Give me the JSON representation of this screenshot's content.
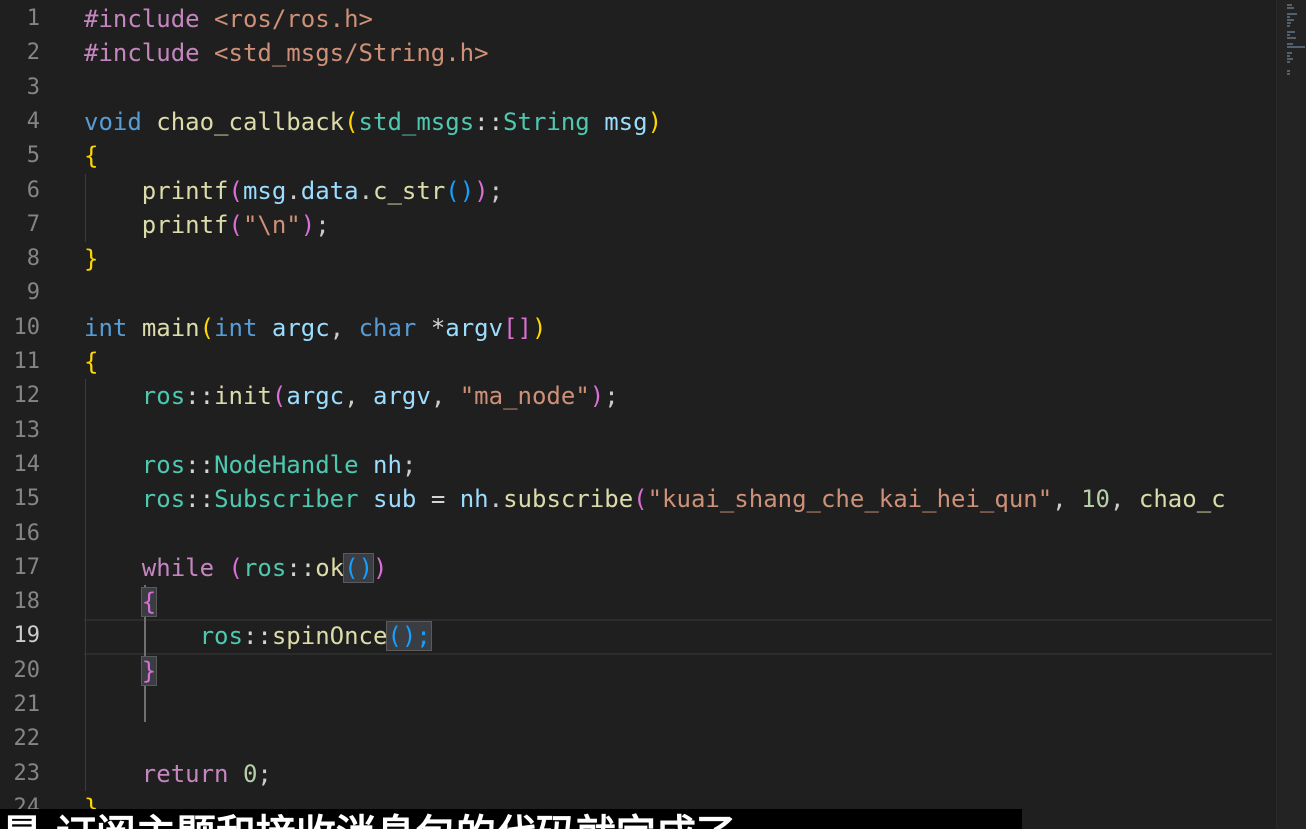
{
  "editor": {
    "active_line": 19,
    "lines": [
      [
        {
          "t": "#include",
          "c": "kw-inc"
        },
        {
          "t": " <ros/ros.h>",
          "c": "inc"
        }
      ],
      [
        {
          "t": "#include",
          "c": "kw-inc"
        },
        {
          "t": " <std_msgs/String.h>",
          "c": "inc"
        }
      ],
      [],
      [
        {
          "t": "void",
          "c": "ty"
        },
        {
          "t": " ",
          "c": "pn"
        },
        {
          "t": "chao_callback",
          "c": "fn"
        },
        {
          "t": "(",
          "c": "p1"
        },
        {
          "t": "std_msgs",
          "c": "ns"
        },
        {
          "t": "::",
          "c": "op"
        },
        {
          "t": "String",
          "c": "ns"
        },
        {
          "t": " ",
          "c": "pn"
        },
        {
          "t": "msg",
          "c": "var"
        },
        {
          "t": ")",
          "c": "p1"
        }
      ],
      [
        {
          "t": "{",
          "c": "p1"
        }
      ],
      [
        {
          "t": "    ",
          "c": "pn"
        },
        {
          "t": "printf",
          "c": "fn"
        },
        {
          "t": "(",
          "c": "p2"
        },
        {
          "t": "msg",
          "c": "var"
        },
        {
          "t": ".",
          "c": "pn"
        },
        {
          "t": "data",
          "c": "var"
        },
        {
          "t": ".",
          "c": "pn"
        },
        {
          "t": "c_str",
          "c": "fn"
        },
        {
          "t": "()",
          "c": "p3"
        },
        {
          "t": ")",
          "c": "p2"
        },
        {
          "t": ";",
          "c": "pn"
        }
      ],
      [
        {
          "t": "    ",
          "c": "pn"
        },
        {
          "t": "printf",
          "c": "fn"
        },
        {
          "t": "(",
          "c": "p2"
        },
        {
          "t": "\"\\n\"",
          "c": "str"
        },
        {
          "t": ")",
          "c": "p2"
        },
        {
          "t": ";",
          "c": "pn"
        }
      ],
      [
        {
          "t": "}",
          "c": "p1"
        }
      ],
      [],
      [
        {
          "t": "int",
          "c": "ty"
        },
        {
          "t": " ",
          "c": "pn"
        },
        {
          "t": "main",
          "c": "fn"
        },
        {
          "t": "(",
          "c": "p1"
        },
        {
          "t": "int",
          "c": "ty"
        },
        {
          "t": " ",
          "c": "pn"
        },
        {
          "t": "argc",
          "c": "var"
        },
        {
          "t": ", ",
          "c": "pn"
        },
        {
          "t": "char",
          "c": "ty"
        },
        {
          "t": " ",
          "c": "pn"
        },
        {
          "t": "*",
          "c": "op"
        },
        {
          "t": "argv",
          "c": "var"
        },
        {
          "t": "[]",
          "c": "p2"
        },
        {
          "t": ")",
          "c": "p1"
        }
      ],
      [
        {
          "t": "{",
          "c": "p1"
        }
      ],
      [
        {
          "t": "    ",
          "c": "pn"
        },
        {
          "t": "ros",
          "c": "ns"
        },
        {
          "t": "::",
          "c": "op"
        },
        {
          "t": "init",
          "c": "fn"
        },
        {
          "t": "(",
          "c": "p2"
        },
        {
          "t": "argc",
          "c": "var"
        },
        {
          "t": ", ",
          "c": "pn"
        },
        {
          "t": "argv",
          "c": "var"
        },
        {
          "t": ", ",
          "c": "pn"
        },
        {
          "t": "\"ma_node\"",
          "c": "str"
        },
        {
          "t": ")",
          "c": "p2"
        },
        {
          "t": ";",
          "c": "pn"
        }
      ],
      [],
      [
        {
          "t": "    ",
          "c": "pn"
        },
        {
          "t": "ros",
          "c": "ns"
        },
        {
          "t": "::",
          "c": "op"
        },
        {
          "t": "NodeHandle",
          "c": "ns"
        },
        {
          "t": " ",
          "c": "pn"
        },
        {
          "t": "nh",
          "c": "var"
        },
        {
          "t": ";",
          "c": "pn"
        }
      ],
      [
        {
          "t": "    ",
          "c": "pn"
        },
        {
          "t": "ros",
          "c": "ns"
        },
        {
          "t": "::",
          "c": "op"
        },
        {
          "t": "Subscriber",
          "c": "ns"
        },
        {
          "t": " ",
          "c": "pn"
        },
        {
          "t": "sub",
          "c": "var"
        },
        {
          "t": " = ",
          "c": "op"
        },
        {
          "t": "nh",
          "c": "var"
        },
        {
          "t": ".",
          "c": "pn"
        },
        {
          "t": "subscribe",
          "c": "fn"
        },
        {
          "t": "(",
          "c": "p2"
        },
        {
          "t": "\"kuai_shang_che_kai_hei_qun\"",
          "c": "str"
        },
        {
          "t": ", ",
          "c": "pn"
        },
        {
          "t": "10",
          "c": "num"
        },
        {
          "t": ", ",
          "c": "pn"
        },
        {
          "t": "chao_c",
          "c": "fn"
        }
      ],
      [],
      [
        {
          "t": "    ",
          "c": "pn"
        },
        {
          "t": "while",
          "c": "kw"
        },
        {
          "t": " ",
          "c": "pn"
        },
        {
          "t": "(",
          "c": "p2"
        },
        {
          "t": "ros",
          "c": "ns"
        },
        {
          "t": "::",
          "c": "op"
        },
        {
          "t": "ok",
          "c": "fn"
        },
        {
          "t": "()",
          "c": "p3",
          "h": true
        },
        {
          "t": ")",
          "c": "p2"
        }
      ],
      [
        {
          "t": "    ",
          "c": "pn"
        },
        {
          "t": "{",
          "c": "p2",
          "h": true
        }
      ],
      [
        {
          "t": "        ",
          "c": "pn"
        },
        {
          "t": "ros",
          "c": "ns"
        },
        {
          "t": "::",
          "c": "op"
        },
        {
          "t": "spinOnce",
          "c": "fn"
        },
        {
          "t": "();",
          "c": "p3",
          "h": true
        }
      ],
      [
        {
          "t": "    ",
          "c": "pn"
        },
        {
          "t": "}",
          "c": "p2",
          "h": true
        }
      ],
      [],
      [],
      [
        {
          "t": "    ",
          "c": "pn"
        },
        {
          "t": "return",
          "c": "kw"
        },
        {
          "t": " ",
          "c": "pn"
        },
        {
          "t": "0",
          "c": "num"
        },
        {
          "t": ";",
          "c": "pn"
        }
      ],
      [
        {
          "t": "}",
          "c": "p1"
        }
      ]
    ]
  },
  "subtitle": {
    "text": "是 订阅主题和接收消息包的代码就完成了"
  },
  "colors": {
    "background": "#1f1f1f",
    "keyword": "#569cd6",
    "function": "#dcdcaa",
    "namespace": "#4ec9b0",
    "string": "#ce9178",
    "number": "#b5cea8"
  }
}
